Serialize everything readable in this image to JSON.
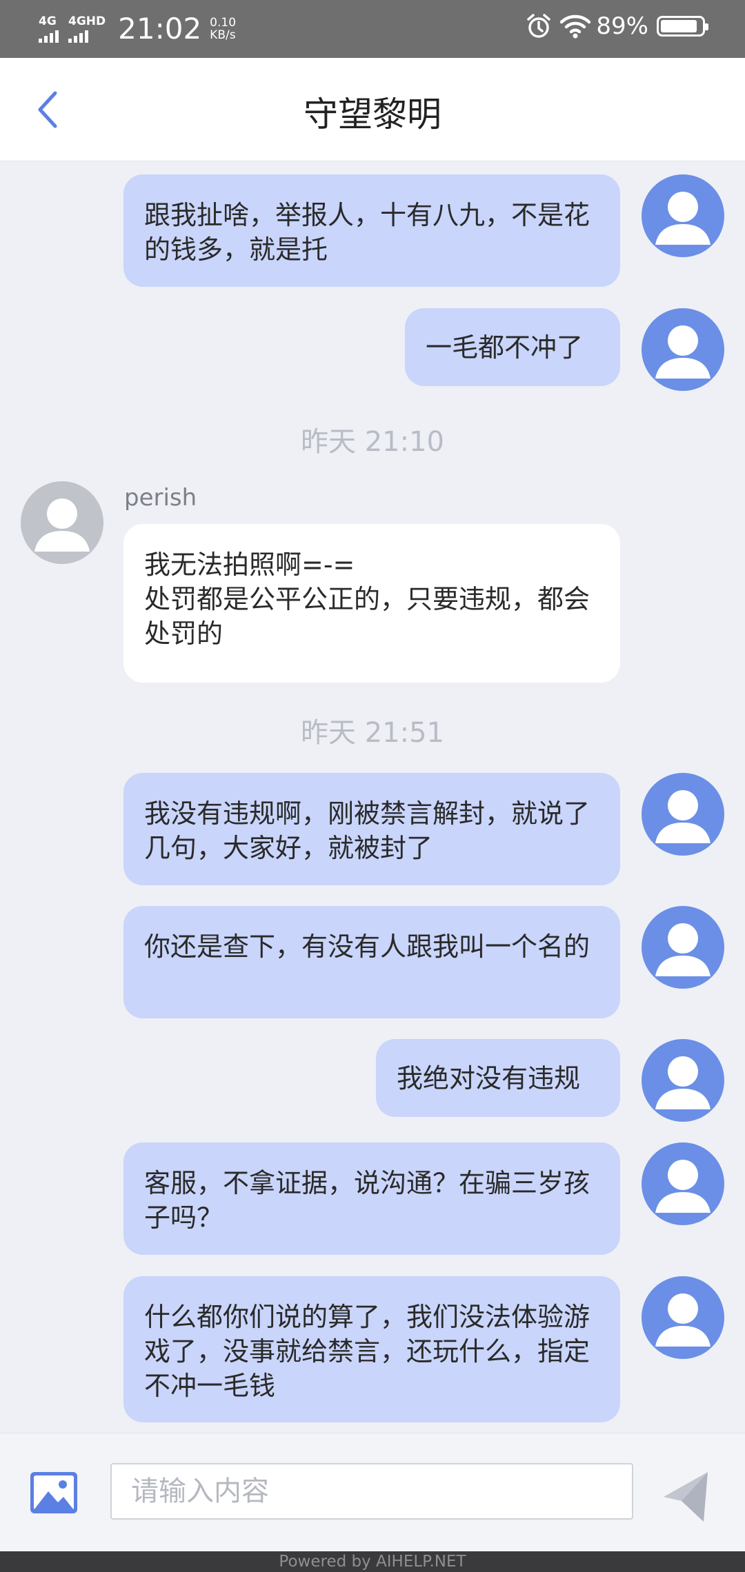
{
  "status_bar": {
    "signal1": "4G",
    "signal2": "4GHD",
    "time": "21:02",
    "speed_value": "0.10",
    "speed_unit": "KB/s",
    "battery": "89%",
    "battery_level": 0.89
  },
  "header": {
    "title": "守望黎明"
  },
  "messages": [
    {
      "side": "out",
      "text": "跟我扯啥，举报人，十有八九，不是花的钱多，就是托"
    },
    {
      "side": "out",
      "text": "一毛都不冲了"
    },
    {
      "type": "time",
      "text": "昨天 21:10"
    },
    {
      "side": "in",
      "sender": "perish",
      "text": "我无法拍照啊=-=\n处罚都是公平公正的，只要违规，都会处罚的"
    },
    {
      "type": "time",
      "text": "昨天 21:51"
    },
    {
      "side": "out",
      "text": "我没有违规啊，刚被禁言解封，就说了几句，大家好，就被封了"
    },
    {
      "side": "out",
      "text": "你还是查下，有没有人跟我叫一个名的"
    },
    {
      "side": "out",
      "text": "我绝对没有违规"
    },
    {
      "side": "out",
      "text": "客服，不拿证据，说沟通？在骗三岁孩子吗？"
    },
    {
      "side": "out",
      "text": "什么都你们说的算了，我们没法体验游戏了，没事就给禁言，还玩什么，指定不冲一毛钱"
    }
  ],
  "input": {
    "placeholder": "请输入内容",
    "value": ""
  },
  "footer": {
    "text": "Powered by AIHELP.NET"
  },
  "colors": {
    "outgoing_bubble": "#c9d5fa",
    "incoming_bubble": "#ffffff",
    "accent": "#5b7fe3",
    "avatar_self": "#6b8fe6",
    "avatar_agent": "#c0c3ca"
  }
}
